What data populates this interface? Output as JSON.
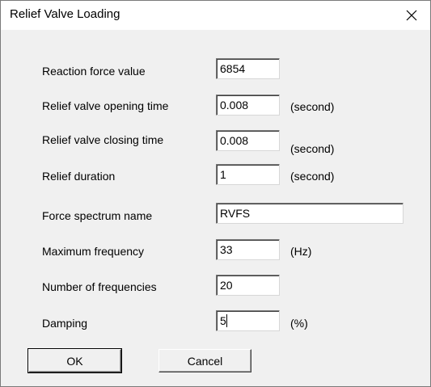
{
  "window": {
    "title": "Relief Valve Loading"
  },
  "form": {
    "reaction_force": {
      "label": "Reaction force value",
      "value": "6854"
    },
    "opening_time": {
      "label": "Relief valve opening time",
      "value": "0.008",
      "unit": "(second)"
    },
    "closing_time": {
      "label": "Relief valve closing time",
      "value": "0.008",
      "unit": "(second)"
    },
    "relief_duration": {
      "label": "Relief duration",
      "value": "1",
      "unit": "(second)"
    },
    "spectrum_name": {
      "label": "Force spectrum name",
      "value": "RVFS"
    },
    "max_frequency": {
      "label": "Maximum frequency",
      "value": "33",
      "unit": "(Hz)"
    },
    "num_frequencies": {
      "label": "Number of frequencies",
      "value": "20"
    },
    "damping": {
      "label": "Damping",
      "value": "5",
      "unit": "(%)"
    }
  },
  "buttons": {
    "ok": "OK",
    "cancel": "Cancel"
  },
  "icons": {
    "close": "close-icon"
  }
}
